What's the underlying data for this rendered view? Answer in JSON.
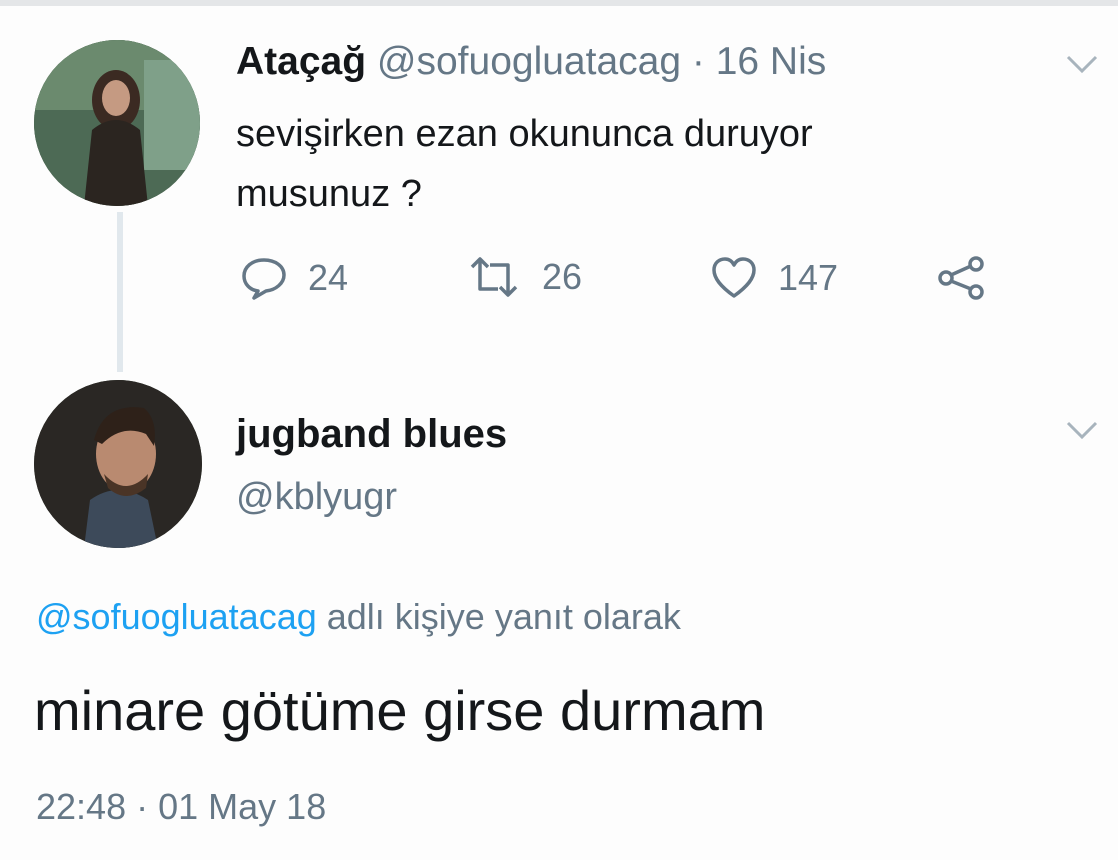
{
  "tweet": {
    "author_name": "Ataçağ",
    "author_handle": "@sofuogluatacag",
    "separator": "·",
    "date": "16 Nis",
    "text_line1": "sevişirken ezan okununca duruyor",
    "text_line2": "musunuz ?",
    "stats": {
      "replies": "24",
      "retweets": "26",
      "likes": "147"
    }
  },
  "reply": {
    "author_name": "jugband blues",
    "author_handle": "@kblyugr",
    "reply_to_handle": "@sofuogluatacag",
    "reply_to_suffix": "adlı kişiye yanıt olarak",
    "text": "minare götüme girse durmam",
    "time": "22:48",
    "separator": "·",
    "date": "01 May 18"
  },
  "colors": {
    "accent": "#1da1f2",
    "muted": "#657786",
    "text": "#14171a"
  },
  "icons": [
    "reply-icon",
    "retweet-icon",
    "like-icon",
    "share-icon",
    "chevron-down-icon"
  ]
}
